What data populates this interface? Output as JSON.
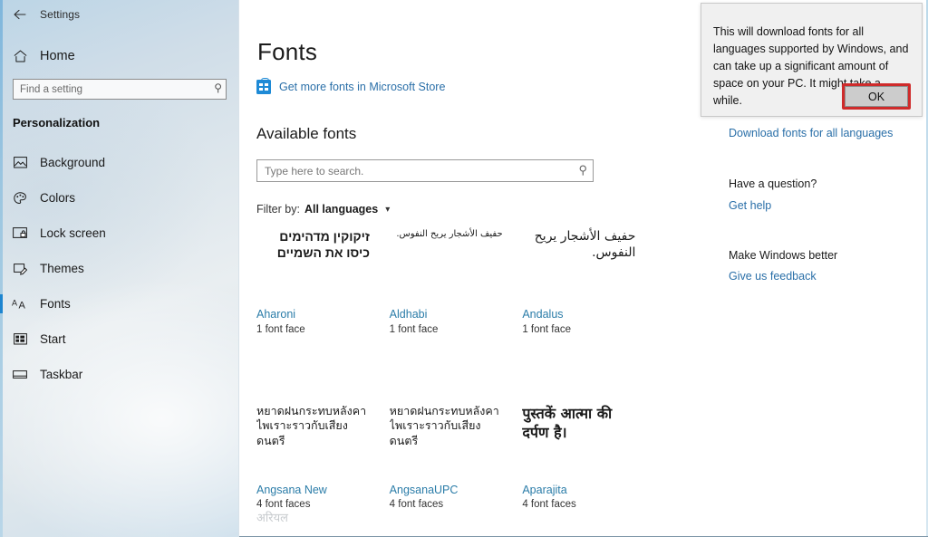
{
  "window": {
    "app_title": "Settings",
    "back_icon": "back-arrow-icon",
    "minimize_label": "–",
    "maximize_label": "☐",
    "close_label": "✕"
  },
  "sidebar": {
    "home_label": "Home",
    "home_icon": "home-icon",
    "search": {
      "placeholder": "Find a setting",
      "value": "",
      "icon": "search-icon"
    },
    "section_header": "Personalization",
    "items": [
      {
        "label": "Background",
        "icon": "image-icon",
        "selected": false
      },
      {
        "label": "Colors",
        "icon": "palette-icon",
        "selected": false
      },
      {
        "label": "Lock screen",
        "icon": "lock-screen-icon",
        "selected": false
      },
      {
        "label": "Themes",
        "icon": "themes-icon",
        "selected": false
      },
      {
        "label": "Fonts",
        "icon": "fonts-aa-icon",
        "selected": true
      },
      {
        "label": "Start",
        "icon": "start-grid-icon",
        "selected": false
      },
      {
        "label": "Taskbar",
        "icon": "taskbar-icon",
        "selected": false
      }
    ],
    "accent_color": "#1d85d0"
  },
  "main": {
    "page_title": "Fonts",
    "store_link": {
      "label": "Get more fonts in Microsoft Store",
      "icon": "microsoft-store-bag-icon"
    },
    "available_header": "Available fonts",
    "font_search": {
      "placeholder": "Type here to search.",
      "value": "",
      "icon": "search-icon"
    },
    "filter": {
      "label": "Filter by:",
      "value": "All languages",
      "caret_icon": "chevron-down-icon"
    },
    "fonts": [
      {
        "name": "Aharoni",
        "faces": "1 font face",
        "preview_text": "זיקוקין מדהימים כיסו את השמיים",
        "preview_style": "pv-heb",
        "script": "hebrew"
      },
      {
        "name": "Aldhabi",
        "faces": "1 font face",
        "preview_text": "حفيف الأشجار يريح النفوس.",
        "preview_style": "pv-ald",
        "script": "arabic"
      },
      {
        "name": "Andalus",
        "faces": "1 font face",
        "preview_text": "حفيف الأشجار يريح النفوس.",
        "preview_style": "pv-and",
        "script": "arabic"
      },
      {
        "name": "Angsana New",
        "faces": "4 font faces",
        "preview_text": "หยาดฝนกระทบหลังคา ไพเราะราวกับเสียงดนตรี",
        "preview_style": "pv-thai",
        "script": "thai"
      },
      {
        "name": "AngsanaUPC",
        "faces": "4 font faces",
        "preview_text": "หยาดฝนกระทบหลังคา ไพเราะราวกับเสียงดนตรี",
        "preview_style": "pv-thai",
        "script": "thai"
      },
      {
        "name": "Aparajita",
        "faces": "4 font faces",
        "preview_text": "पुस्तकें आत्मा की दर्पण है।",
        "preview_style": "pv-dev",
        "script": "devanagari"
      }
    ],
    "partial_row_text": "अरियल"
  },
  "right_rail": {
    "download_link": "Download fonts for all languages",
    "question_header": "Have a question?",
    "help_link": "Get help",
    "better_header": "Make Windows better",
    "feedback_link": "Give us feedback",
    "link_color": "#2a6fa8"
  },
  "dialog": {
    "message": "This will download fonts for all languages supported by Windows, and can take up a significant amount of space on your PC. It might take a while.",
    "ok_label": "OK",
    "highlight_color": "#cf2b2b"
  }
}
